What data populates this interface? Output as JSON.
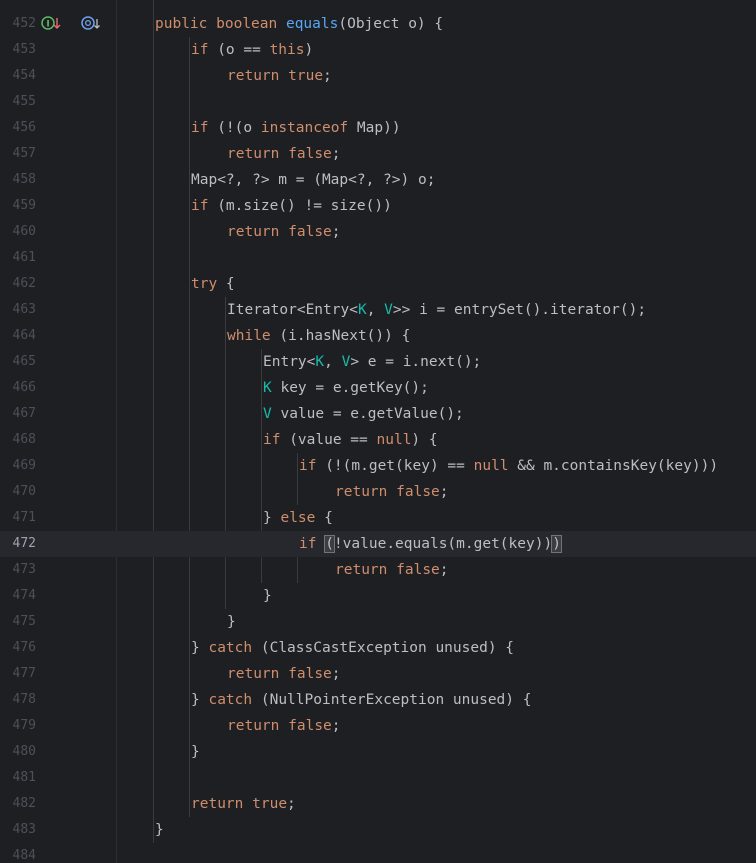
{
  "editor": {
    "language": "java",
    "current_line": "472",
    "gutter_icons": [
      {
        "name": "implementation-marker-icon",
        "glyph": "I↑"
      },
      {
        "name": "method-recursion-override-icon",
        "glyph": "◎↓"
      }
    ],
    "colors": {
      "background": "#1e1f22",
      "current_line_background": "#26282e",
      "default_text": "#bcbec4",
      "keyword": "#cf8e6d",
      "method_declaration": "#56a8f5",
      "type_parameter": "#16baac",
      "line_number": "#4b5059"
    },
    "lines": [
      {
        "num": "452",
        "indent": 1,
        "tokens": [
          {
            "t": "public",
            "k": "kw"
          },
          {
            "t": " "
          },
          {
            "t": "boolean",
            "k": "kw"
          },
          {
            "t": " "
          },
          {
            "t": "equals",
            "k": "fn"
          },
          {
            "t": "(Object o) {"
          }
        ]
      },
      {
        "num": "453",
        "indent": 2,
        "tokens": [
          {
            "t": "if",
            "k": "kw"
          },
          {
            "t": " (o == "
          },
          {
            "t": "this",
            "k": "kw"
          },
          {
            "t": ")"
          }
        ]
      },
      {
        "num": "454",
        "indent": 3,
        "tokens": [
          {
            "t": "return",
            "k": "kw"
          },
          {
            "t": " "
          },
          {
            "t": "true",
            "k": "kw"
          },
          {
            "t": ";"
          }
        ]
      },
      {
        "num": "455",
        "indent": 0,
        "tokens": []
      },
      {
        "num": "456",
        "indent": 2,
        "tokens": [
          {
            "t": "if",
            "k": "kw"
          },
          {
            "t": " (!(o "
          },
          {
            "t": "instanceof",
            "k": "kw"
          },
          {
            "t": " Map))"
          }
        ]
      },
      {
        "num": "457",
        "indent": 3,
        "tokens": [
          {
            "t": "return",
            "k": "kw"
          },
          {
            "t": " "
          },
          {
            "t": "false",
            "k": "kw"
          },
          {
            "t": ";"
          }
        ]
      },
      {
        "num": "458",
        "indent": 2,
        "tokens": [
          {
            "t": "Map<?, ?> m = (Map<?, ?>) o;"
          }
        ]
      },
      {
        "num": "459",
        "indent": 2,
        "tokens": [
          {
            "t": "if",
            "k": "kw"
          },
          {
            "t": " (m.size() != size())"
          }
        ]
      },
      {
        "num": "460",
        "indent": 3,
        "tokens": [
          {
            "t": "return",
            "k": "kw"
          },
          {
            "t": " "
          },
          {
            "t": "false",
            "k": "kw"
          },
          {
            "t": ";"
          }
        ]
      },
      {
        "num": "461",
        "indent": 0,
        "tokens": []
      },
      {
        "num": "462",
        "indent": 2,
        "tokens": [
          {
            "t": "try",
            "k": "kw"
          },
          {
            "t": " {"
          }
        ]
      },
      {
        "num": "463",
        "indent": 3,
        "tokens": [
          {
            "t": "Iterator<Entry<"
          },
          {
            "t": "K",
            "k": "tp"
          },
          {
            "t": ", "
          },
          {
            "t": "V",
            "k": "tp"
          },
          {
            "t": ">> i = entrySet().iterator();"
          }
        ]
      },
      {
        "num": "464",
        "indent": 3,
        "tokens": [
          {
            "t": "while",
            "k": "kw"
          },
          {
            "t": " (i.hasNext()) {"
          }
        ]
      },
      {
        "num": "465",
        "indent": 4,
        "tokens": [
          {
            "t": "Entry<"
          },
          {
            "t": "K",
            "k": "tp"
          },
          {
            "t": ", "
          },
          {
            "t": "V",
            "k": "tp"
          },
          {
            "t": "> e = i.next();"
          }
        ]
      },
      {
        "num": "466",
        "indent": 4,
        "tokens": [
          {
            "t": "K",
            "k": "tp"
          },
          {
            "t": " key = e.getKey();"
          }
        ]
      },
      {
        "num": "467",
        "indent": 4,
        "tokens": [
          {
            "t": "V",
            "k": "tp"
          },
          {
            "t": " value = e.getValue();"
          }
        ]
      },
      {
        "num": "468",
        "indent": 4,
        "tokens": [
          {
            "t": "if",
            "k": "kw"
          },
          {
            "t": " (value == "
          },
          {
            "t": "null",
            "k": "kw"
          },
          {
            "t": ") {"
          }
        ]
      },
      {
        "num": "469",
        "indent": 5,
        "tokens": [
          {
            "t": "if",
            "k": "kw"
          },
          {
            "t": " (!(m.get(key) == "
          },
          {
            "t": "null",
            "k": "kw"
          },
          {
            "t": " && m.containsKey(key)))"
          }
        ]
      },
      {
        "num": "470",
        "indent": 6,
        "tokens": [
          {
            "t": "return",
            "k": "kw"
          },
          {
            "t": " "
          },
          {
            "t": "false",
            "k": "kw"
          },
          {
            "t": ";"
          }
        ]
      },
      {
        "num": "471",
        "indent": 4,
        "tokens": [
          {
            "t": "} "
          },
          {
            "t": "else",
            "k": "kw"
          },
          {
            "t": " {"
          }
        ]
      },
      {
        "num": "472",
        "indent": 5,
        "tokens": [
          {
            "t": "if",
            "k": "kw"
          },
          {
            "t": " "
          },
          {
            "t": "(",
            "k": "caret"
          },
          {
            "t": "!value.equals(m.get(key))"
          },
          {
            "t": ")",
            "k": "caret"
          }
        ]
      },
      {
        "num": "473",
        "indent": 6,
        "tokens": [
          {
            "t": "return",
            "k": "kw"
          },
          {
            "t": " "
          },
          {
            "t": "false",
            "k": "kw"
          },
          {
            "t": ";"
          }
        ]
      },
      {
        "num": "474",
        "indent": 4,
        "tokens": [
          {
            "t": "}"
          }
        ]
      },
      {
        "num": "475",
        "indent": 3,
        "tokens": [
          {
            "t": "}"
          }
        ]
      },
      {
        "num": "476",
        "indent": 2,
        "tokens": [
          {
            "t": "} "
          },
          {
            "t": "catch",
            "k": "kw"
          },
          {
            "t": " (ClassCastException unused) {"
          }
        ]
      },
      {
        "num": "477",
        "indent": 3,
        "tokens": [
          {
            "t": "return",
            "k": "kw"
          },
          {
            "t": " "
          },
          {
            "t": "false",
            "k": "kw"
          },
          {
            "t": ";"
          }
        ]
      },
      {
        "num": "478",
        "indent": 2,
        "tokens": [
          {
            "t": "} "
          },
          {
            "t": "catch",
            "k": "kw"
          },
          {
            "t": " (NullPointerException unused) {"
          }
        ]
      },
      {
        "num": "479",
        "indent": 3,
        "tokens": [
          {
            "t": "return",
            "k": "kw"
          },
          {
            "t": " "
          },
          {
            "t": "false",
            "k": "kw"
          },
          {
            "t": ";"
          }
        ]
      },
      {
        "num": "480",
        "indent": 2,
        "tokens": [
          {
            "t": "}"
          }
        ]
      },
      {
        "num": "481",
        "indent": 0,
        "tokens": []
      },
      {
        "num": "482",
        "indent": 2,
        "tokens": [
          {
            "t": "return",
            "k": "kw"
          },
          {
            "t": " "
          },
          {
            "t": "true",
            "k": "kw"
          },
          {
            "t": ";"
          }
        ]
      },
      {
        "num": "483",
        "indent": 1,
        "tokens": [
          {
            "t": "}"
          }
        ]
      },
      {
        "num": "484",
        "indent": 0,
        "tokens": []
      }
    ]
  }
}
